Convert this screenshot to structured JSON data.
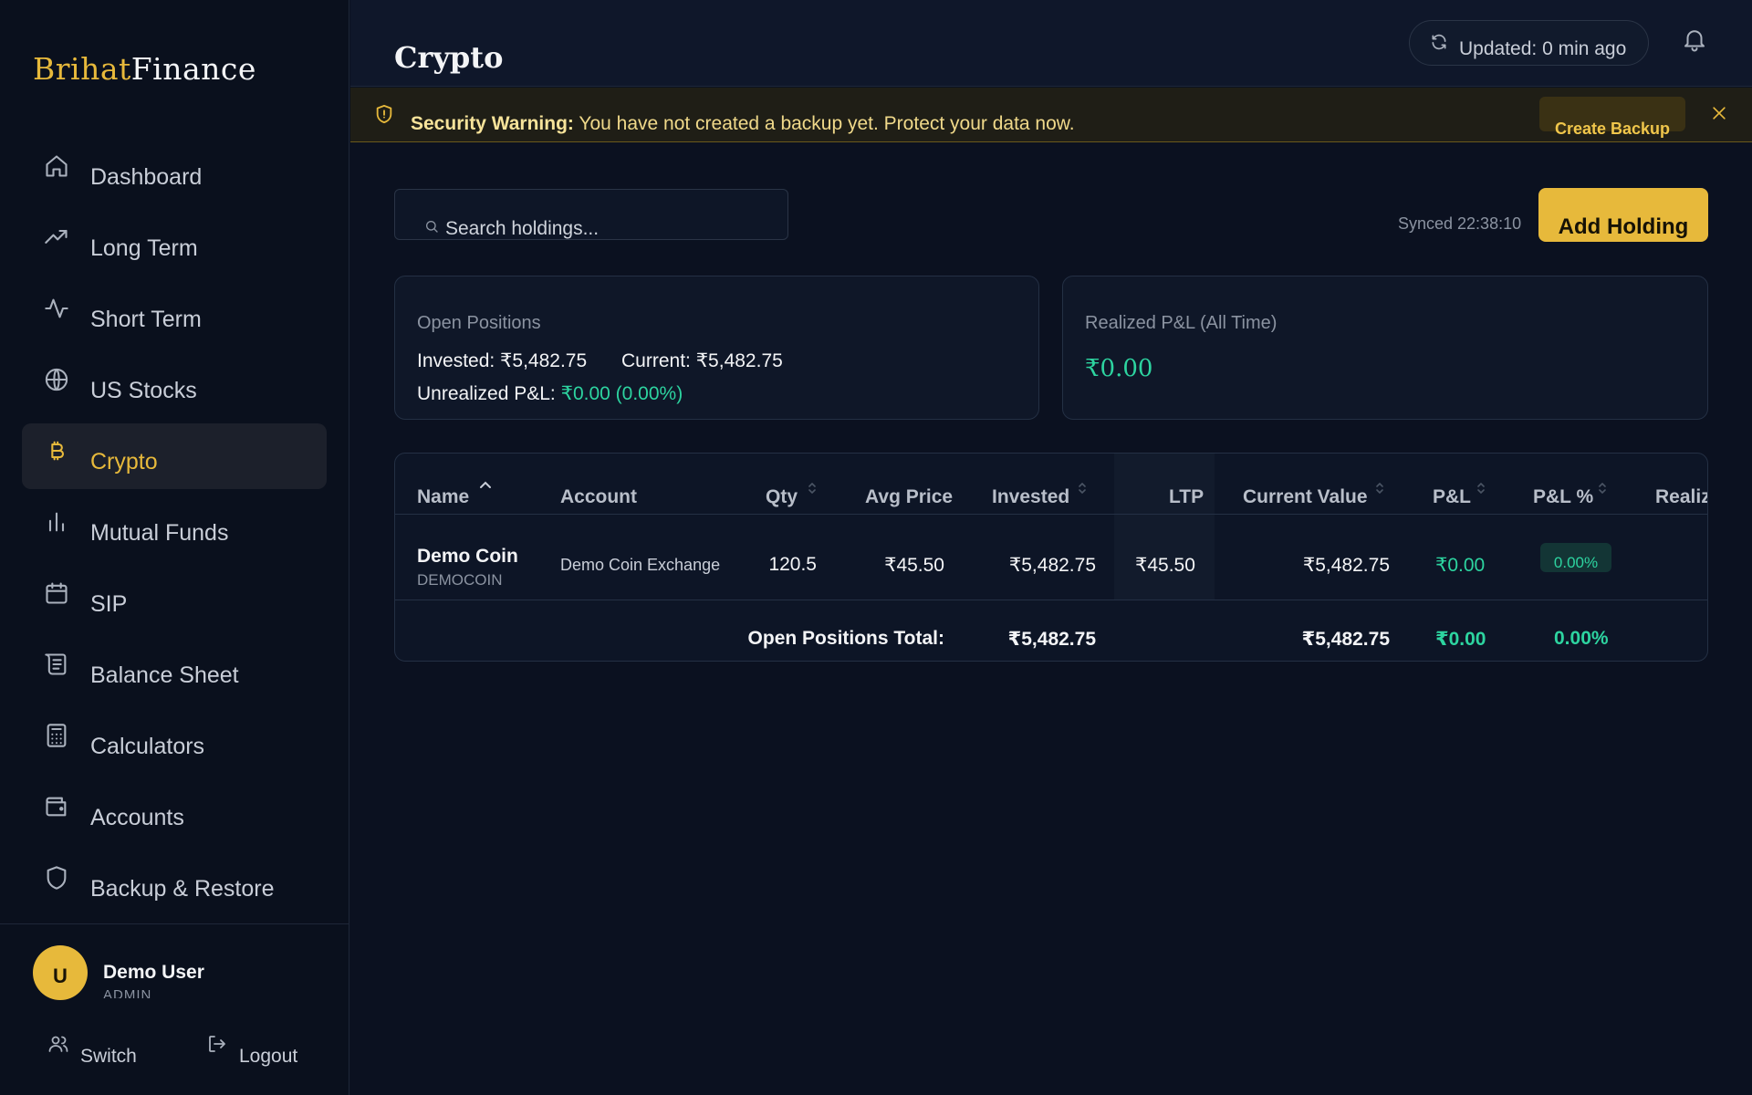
{
  "brand": {
    "part1": "Brihat",
    "part2": "Finance"
  },
  "nav": [
    {
      "label": "Dashboard",
      "icon": "home-icon"
    },
    {
      "label": "Long Term",
      "icon": "trending-up-icon"
    },
    {
      "label": "Short Term",
      "icon": "activity-icon"
    },
    {
      "label": "US Stocks",
      "icon": "globe-icon"
    },
    {
      "label": "Crypto",
      "icon": "bitcoin-icon",
      "active": true
    },
    {
      "label": "Mutual Funds",
      "icon": "bar-chart-icon"
    },
    {
      "label": "SIP",
      "icon": "calendar-icon"
    },
    {
      "label": "Balance Sheet",
      "icon": "scroll-icon"
    },
    {
      "label": "Calculators",
      "icon": "calculator-icon"
    },
    {
      "label": "Accounts",
      "icon": "wallet-icon"
    },
    {
      "label": "Backup & Restore",
      "icon": "shield-icon"
    }
  ],
  "user": {
    "initial": "U",
    "name": "Demo User",
    "role": "ADMIN"
  },
  "footer": {
    "switch_label": "Switch",
    "logout_label": "Logout"
  },
  "header": {
    "title": "Crypto",
    "updated": "Updated: 0 min ago"
  },
  "warning": {
    "title": "Security Warning:",
    "message": " You have not created a backup yet. Protect your data now.",
    "button": "Create Backup"
  },
  "toolbar": {
    "search_placeholder": "Search holdings...",
    "synced": "Synced 22:38:10",
    "add_button": "Add Holding"
  },
  "summary": {
    "open_title": "Open Positions",
    "invested": "Invested: ₹5,482.75",
    "current": "Current: ₹5,482.75",
    "unrealized_label": "Unrealized P&L: ",
    "unrealized_value": "₹0.00 (0.00%)",
    "realized_title": "Realized P&L (All Time)",
    "realized_value": "₹0.00"
  },
  "table": {
    "headers": {
      "name": "Name",
      "account": "Account",
      "qty": "Qty",
      "avg_price": "Avg Price",
      "invested": "Invested",
      "ltp": "LTP",
      "current_value": "Current Value",
      "pnl": "P&L",
      "pnl_pct": "P&L %",
      "realized": "Realiz"
    },
    "row": {
      "name": "Demo Coin",
      "symbol": "DEMOCOIN",
      "account": "Demo Coin Exchange",
      "qty": "120.5",
      "avg_price": "₹45.50",
      "invested": "₹5,482.75",
      "ltp": "₹45.50",
      "current_value": "₹5,482.75",
      "pnl": "₹0.00",
      "pnl_pct": "0.00%"
    },
    "total": {
      "label": "Open Positions Total:",
      "invested": "₹5,482.75",
      "current_value": "₹5,482.75",
      "pnl": "₹0.00",
      "pnl_pct": "0.00%"
    }
  },
  "colors": {
    "accent": "#e7b93b",
    "positive": "#2dd4a0",
    "background": "#0b1120"
  }
}
